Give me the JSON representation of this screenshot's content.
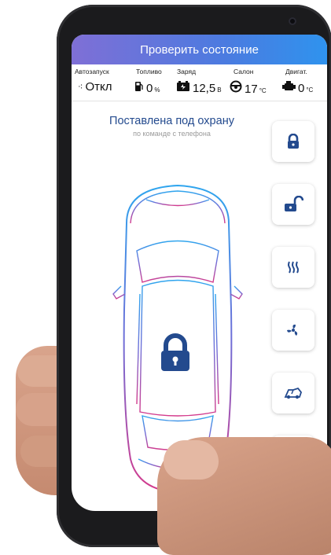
{
  "header": {
    "check_status_label": "Проверить состояние"
  },
  "info": {
    "labels": [
      "Автозапуск",
      "Топливо",
      "Заряд",
      "Салон",
      "Двигат."
    ],
    "autostart": {
      "value": "Откл"
    },
    "fuel": {
      "value": "0",
      "unit": "%"
    },
    "charge": {
      "value": "12,5",
      "unit": "В"
    },
    "cabin": {
      "value": "17",
      "unit": "°C"
    },
    "engine": {
      "value": "0",
      "unit": "°C"
    }
  },
  "status": {
    "title": "Поставлена под охрану",
    "subtitle": "по команде с телефона"
  },
  "side_buttons": [
    "lock-icon",
    "unlock-icon",
    "heater-icon",
    "fan-icon",
    "trunk-icon",
    "horn-icon"
  ],
  "colors": {
    "accent_start": "#7f6fd6",
    "accent_end": "#2f93ee",
    "icon": "#234a8e"
  }
}
